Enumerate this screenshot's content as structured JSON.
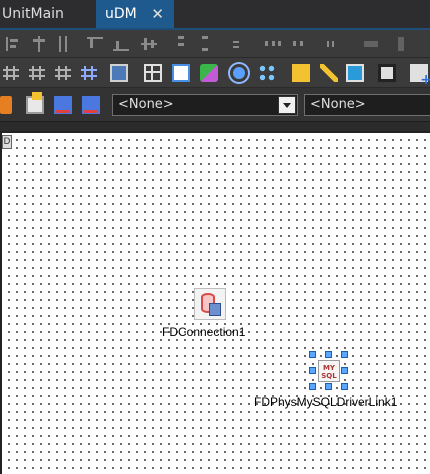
{
  "tabs": [
    {
      "label": "UnitMain"
    },
    {
      "label": "uDM"
    }
  ],
  "tab_close_glyph": "✕",
  "toolbar3": {
    "combo1": "<None>",
    "combo2": "<None>"
  },
  "designer": {
    "corner_marker": "D",
    "components": [
      {
        "label": "FDConnection1",
        "icon": "database-icon"
      },
      {
        "label": "FDPhysMySQLDriverLink1",
        "icon": "mysql-icon",
        "icon_text": "MY SQL"
      }
    ]
  },
  "colors": {
    "active_tab": "#1f5a8f",
    "tab_underline": "#1e4d78",
    "selection_handle": "#5aa7ff",
    "designer_bg": "#ffffff"
  }
}
